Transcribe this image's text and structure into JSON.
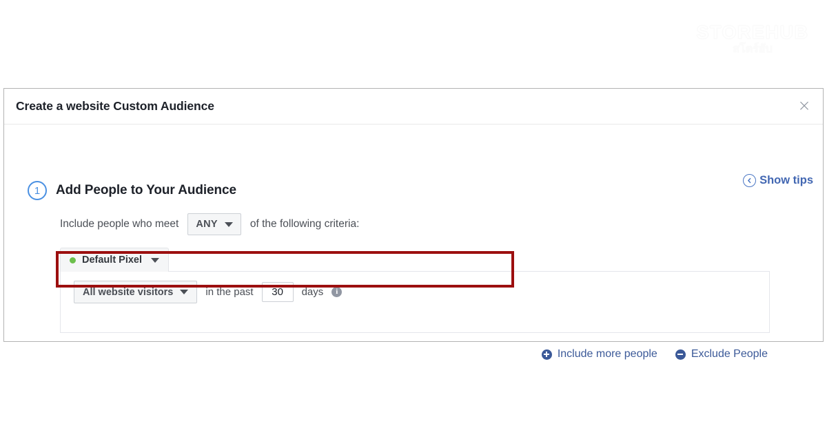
{
  "watermark": {
    "title": "STOREHUB",
    "subtitle": "สโตร์ฮับ"
  },
  "dialog": {
    "title": "Create a website Custom Audience",
    "close_icon": "close-icon",
    "close_glyph": "×",
    "show_tips": {
      "label": "Show tips",
      "icon": "chevron-left-circle-icon"
    },
    "step": {
      "number": "1",
      "title": "Add People to Your Audience"
    },
    "criteria": {
      "prefix": "Include people who meet",
      "match_selector": {
        "value": "ANY",
        "icon": "chevron-down-icon"
      },
      "suffix": "of the following criteria:"
    },
    "pixel_tab": {
      "label": "Default Pixel",
      "status_icon": "status-dot-icon",
      "status_color": "#6cbf4c",
      "caret_icon": "chevron-down-icon"
    },
    "rule": {
      "audience_selector": {
        "value": "All website visitors",
        "icon": "chevron-down-icon"
      },
      "in_the_past": "in the past",
      "days_value": "30",
      "days_placeholder": "30",
      "days_label": "days",
      "info_icon": "info-icon",
      "info_glyph": "i"
    },
    "actions": {
      "include": {
        "label": "Include more people",
        "icon": "plus-circle-icon"
      },
      "exclude": {
        "label": "Exclude People",
        "icon": "minus-circle-icon"
      }
    },
    "highlight_color": "#9c0f0f",
    "accent_color": "#3b5998"
  }
}
